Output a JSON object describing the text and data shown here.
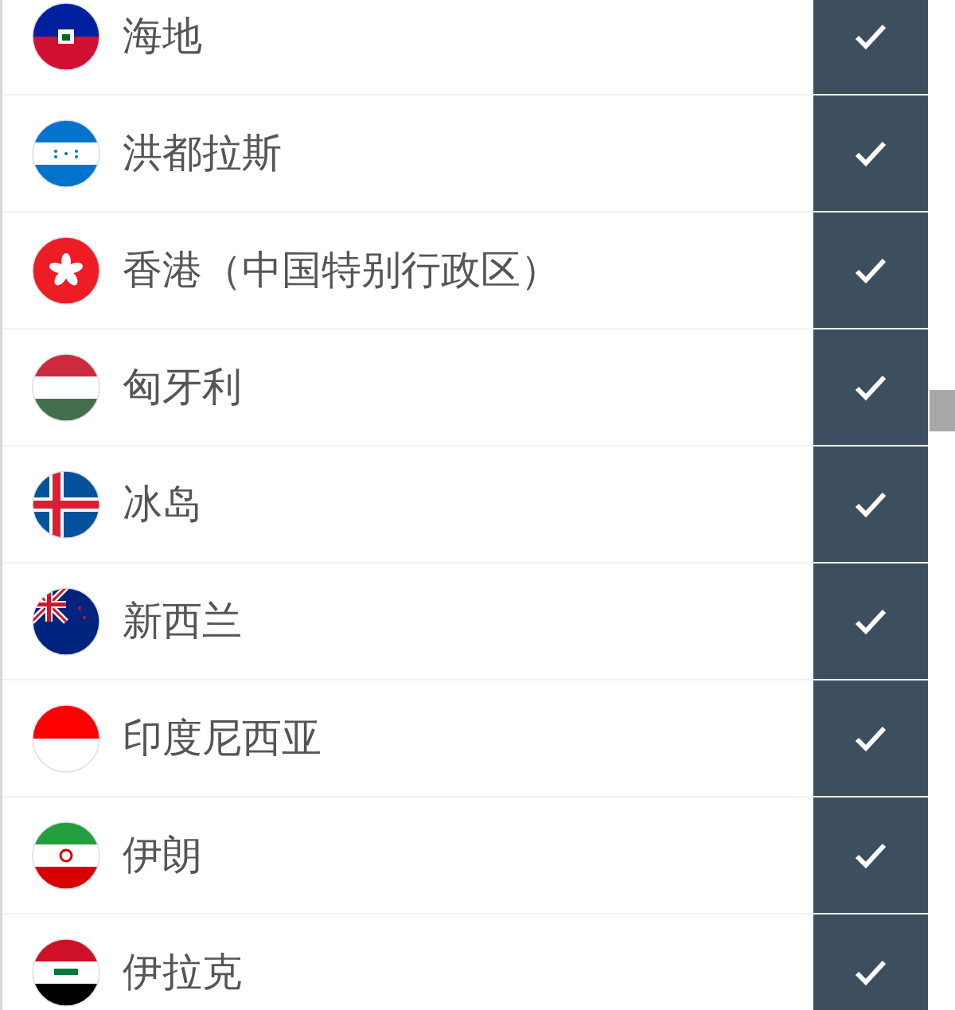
{
  "countries": [
    {
      "name": "海地",
      "checked": true
    },
    {
      "name": "洪都拉斯",
      "checked": true
    },
    {
      "name": "香港（中国特别行政区）",
      "checked": true
    },
    {
      "name": "匈牙利",
      "checked": true
    },
    {
      "name": "冰岛",
      "checked": true
    },
    {
      "name": "新西兰",
      "checked": true
    },
    {
      "name": "印度尼西亚",
      "checked": true
    },
    {
      "name": "伊朗",
      "checked": true
    },
    {
      "name": "伊拉克",
      "checked": true
    }
  ]
}
